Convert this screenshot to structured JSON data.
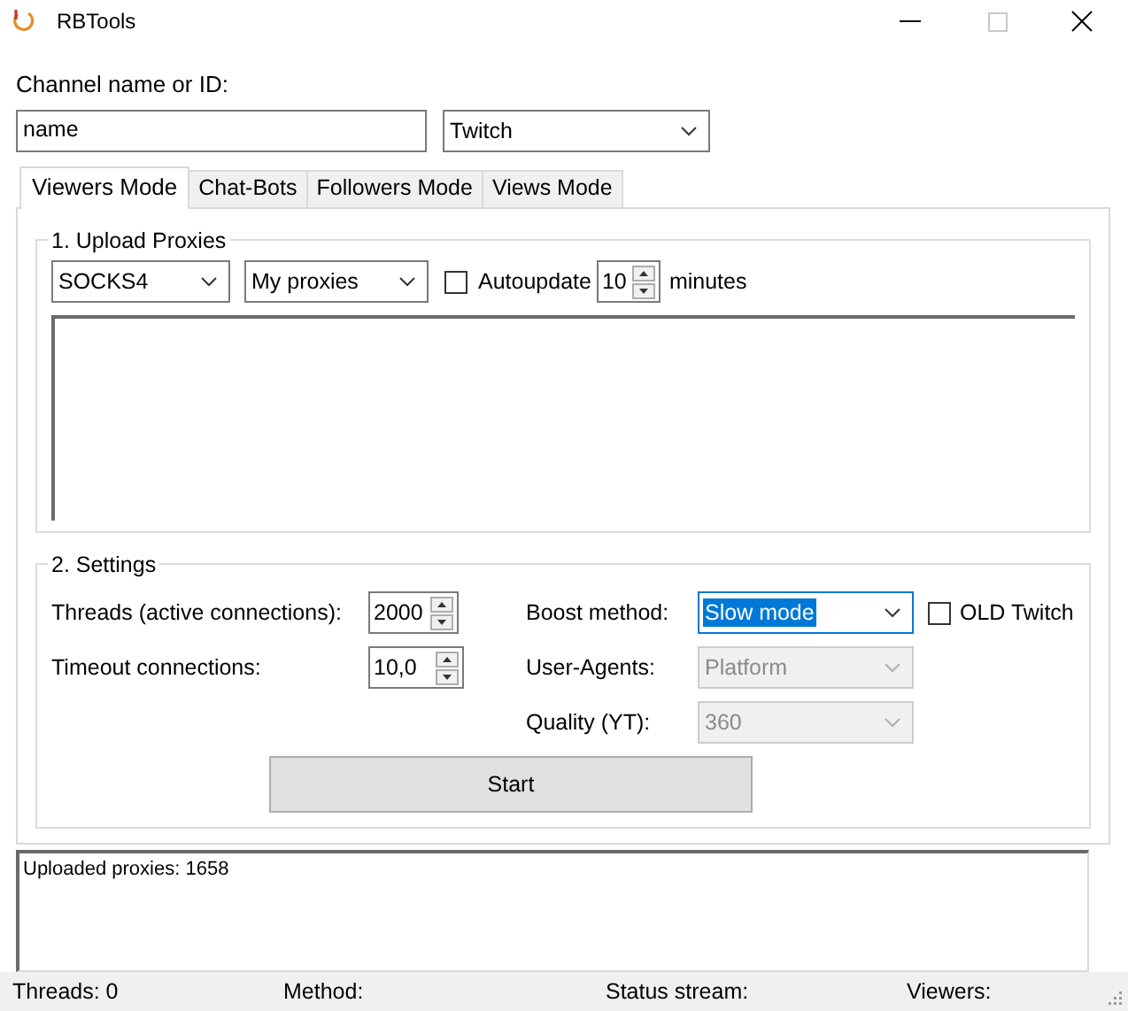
{
  "window": {
    "title": "RBTools"
  },
  "channel": {
    "label": "Channel name or ID:",
    "value": "name",
    "platform": "Twitch"
  },
  "tabs": [
    {
      "label": "Viewers Mode",
      "selected": true
    },
    {
      "label": "Chat-Bots",
      "selected": false
    },
    {
      "label": "Followers Mode",
      "selected": false
    },
    {
      "label": "Views Mode",
      "selected": false
    }
  ],
  "upload_proxies": {
    "title": "1. Upload Proxies",
    "proxy_type": "SOCKS4",
    "source": "My proxies",
    "autoupdate": {
      "label": "Autoupdate",
      "checked": false
    },
    "interval": "10",
    "unit": "minutes"
  },
  "settings": {
    "title": "2. Settings",
    "threads": {
      "label": "Threads (active connections):",
      "value": "2000"
    },
    "timeout": {
      "label": "Timeout connections:",
      "value": "10,0"
    },
    "boost_method": {
      "label": "Boost method:",
      "value": "Slow mode",
      "focused": true,
      "disabled": false
    },
    "old_twitch": {
      "label": "OLD Twitch",
      "checked": false
    },
    "user_agents": {
      "label": "User-Agents:",
      "value": "Platform",
      "disabled": true
    },
    "quality": {
      "label": "Quality (YT):",
      "value": "360",
      "disabled": true
    }
  },
  "start_button": "Start",
  "log": [
    "Uploaded proxies: 1658"
  ],
  "status_bar": [
    "Threads: 0",
    "Method:",
    "Status stream:",
    "Viewers:"
  ]
}
